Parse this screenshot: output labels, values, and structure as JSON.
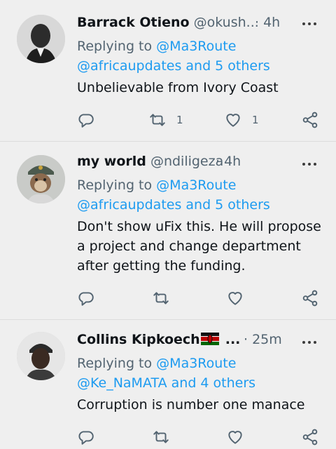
{
  "tweets": [
    {
      "name": "Barrack Otieno",
      "handle": "@okush...",
      "time": "4h",
      "reply_prefix": "Replying to",
      "reply_to": "@Ma3Route",
      "reply_others": "@africaupdates and 5 others",
      "text": [
        "Unbelievable from Ivory Coast"
      ],
      "retweets": "1",
      "likes": "1"
    },
    {
      "name": "my world",
      "handle": "@ndiligeza",
      "time": "4h",
      "reply_prefix": "Replying to",
      "reply_to": "@Ma3Route",
      "reply_others": "@africaupdates and 5 others",
      "text": [
        "Don't show uFix this. He will propose",
        "a project and change department",
        "after getting the funding."
      ],
      "retweets": "",
      "likes": ""
    },
    {
      "name": "Collins Kipkoech",
      "name_suffix": "...",
      "handle": "",
      "time": "25m",
      "reply_prefix": "Replying to",
      "reply_to": "@Ma3Route",
      "reply_others": "@Ke_NaMATA and 4 others",
      "text": [
        "Corruption is number one manace"
      ],
      "retweets": "",
      "likes": ""
    }
  ],
  "icons": {
    "reply": "reply-icon",
    "retweet": "retweet-icon",
    "like": "heart-icon",
    "share": "share-icon",
    "more": "more-icon"
  },
  "colors": {
    "background": "#efefef",
    "link": "#1d9bf0",
    "secondary_text": "#536471",
    "primary_text": "#0f1419"
  }
}
